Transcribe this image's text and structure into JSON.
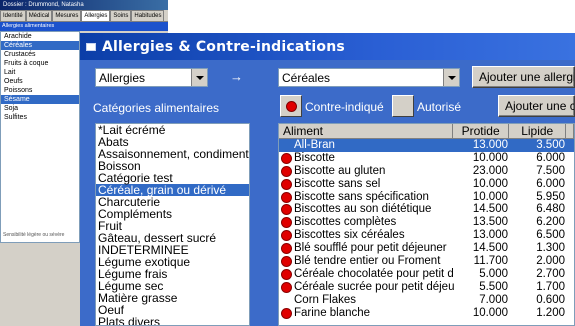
{
  "background_window": {
    "title": "Dossier : Drummond, Natasha",
    "tabs": [
      "Identité",
      "Médical",
      "Mesures",
      "Allergies",
      "Soins",
      "Habitudes"
    ],
    "active_tab": "Allergies",
    "subheader": "Allergies alimentaires",
    "list_items": [
      "Arachide",
      "Céréales",
      "Crustacés",
      "Fruits à coque",
      "Lait",
      "Oeufs",
      "Poissons",
      "Sésame",
      "Soja",
      "Sulfites"
    ],
    "selected_items": [
      "Céréales",
      "Sésame"
    ],
    "footnote": "Sensibilité légère ou sévère"
  },
  "dialog": {
    "title": "Allergies & Contre-indications",
    "left_combo_value": "Allergies",
    "arrow": "→",
    "right_combo_value": "Céréales",
    "add_allergy_button": "Ajouter une allergie",
    "add_second_button": "Ajouter une c",
    "categories_label": "Catégories alimentaires",
    "contra_label": "Contre-indiqué",
    "authorized_label": "Autorisé",
    "categories": [
      "*Lait écrémé",
      "Abats",
      "Assaisonnement, condiment",
      "Boisson",
      "Catégorie test",
      "Céréale, grain ou dérivé",
      "Charcuterie",
      "Compléments",
      "Fruit",
      "Gâteau, dessert sucré",
      "INDETERMINEE",
      "Légume exotique",
      "Légume frais",
      "Légume sec",
      "Matière grasse",
      "Oeuf",
      "Plats divers"
    ],
    "selected_category": "Céréale, grain ou dérivé",
    "table": {
      "headers": [
        "Aliment",
        "Protide",
        "Lipide"
      ],
      "rows": [
        {
          "name": "All-Bran",
          "protide": "13.000",
          "lipide": "3.500",
          "contra": false,
          "selected": true
        },
        {
          "name": "Biscotte",
          "protide": "10.000",
          "lipide": "6.000",
          "contra": true,
          "selected": false
        },
        {
          "name": "Biscotte au gluten",
          "protide": "23.000",
          "lipide": "7.500",
          "contra": true,
          "selected": false
        },
        {
          "name": "Biscotte sans sel",
          "protide": "10.000",
          "lipide": "6.000",
          "contra": true,
          "selected": false
        },
        {
          "name": "Biscotte sans spécification",
          "protide": "10.000",
          "lipide": "5.950",
          "contra": true,
          "selected": false
        },
        {
          "name": "Biscottes au son diététique",
          "protide": "14.500",
          "lipide": "6.480",
          "contra": true,
          "selected": false
        },
        {
          "name": "Biscottes complètes",
          "protide": "13.500",
          "lipide": "6.200",
          "contra": true,
          "selected": false
        },
        {
          "name": "Biscottes six céréales",
          "protide": "13.000",
          "lipide": "6.500",
          "contra": true,
          "selected": false
        },
        {
          "name": "Blé soufflé pour petit déjeuner",
          "protide": "14.500",
          "lipide": "1.300",
          "contra": true,
          "selected": false
        },
        {
          "name": "Blé tendre entier ou Froment",
          "protide": "11.700",
          "lipide": "2.000",
          "contra": true,
          "selected": false
        },
        {
          "name": "Céréale chocolatée pour petit d...",
          "protide": "5.000",
          "lipide": "2.700",
          "contra": true,
          "selected": false
        },
        {
          "name": "Céréale sucrée pour petit déjeu...",
          "protide": "5.500",
          "lipide": "1.700",
          "contra": true,
          "selected": false
        },
        {
          "name": "Corn Flakes",
          "protide": "7.000",
          "lipide": "0.600",
          "contra": false,
          "selected": false
        },
        {
          "name": "Farine blanche",
          "protide": "10.000",
          "lipide": "1.200",
          "contra": true,
          "selected": false
        }
      ]
    }
  },
  "colors": {
    "dialog_bg": "#3c6bc9",
    "selection": "#316ac5",
    "contra_dot": "#e00000"
  }
}
